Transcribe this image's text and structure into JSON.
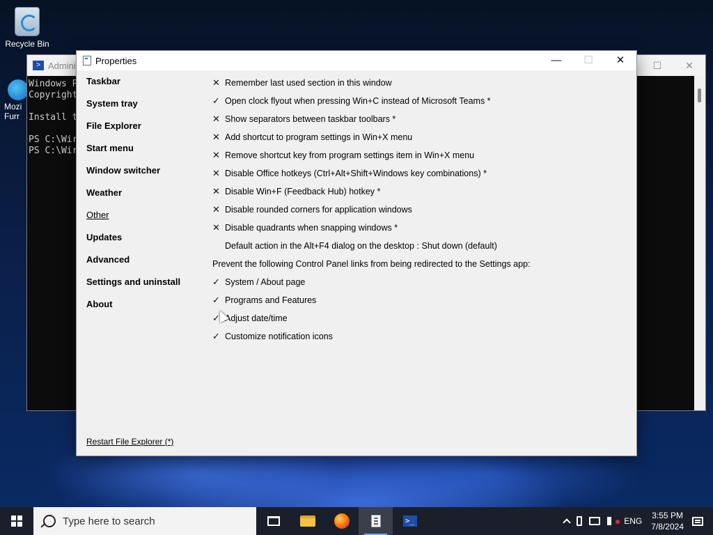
{
  "desktop": {
    "recycle_bin_label": "Recycle Bin",
    "edge_icon_label_1": "Mozi",
    "edge_icon_label_2": "Furr"
  },
  "terminal": {
    "title": "Admini",
    "lines": [
      "Windows P",
      "Copyright",
      "",
      "Install t",
      "",
      "PS C:\\Wir",
      "PS C:\\Wir"
    ]
  },
  "properties": {
    "title": "Properties",
    "window_controls": {
      "minimize": "—",
      "maximize": "☐",
      "close": "✕"
    },
    "nav": [
      "Taskbar",
      "System tray",
      "File Explorer",
      "Start menu",
      "Window switcher",
      "Weather",
      "Other",
      "Updates",
      "Advanced",
      "Settings and uninstall",
      "About"
    ],
    "active_nav": "Other",
    "options": [
      {
        "mark": "✕",
        "text": "Remember last used section in this window"
      },
      {
        "mark": "✓",
        "text": "Open clock flyout when pressing Win+C instead of Microsoft Teams *"
      },
      {
        "mark": "✕",
        "text": "Show separators between taskbar toolbars *"
      },
      {
        "mark": "✕",
        "text": "Add shortcut to program settings in Win+X menu"
      },
      {
        "mark": "✕",
        "text": "Remove shortcut key from program settings item in Win+X menu"
      },
      {
        "mark": "✕",
        "text": "Disable Office hotkeys (Ctrl+Alt+Shift+Windows key combinations) *"
      },
      {
        "mark": "✕",
        "text": "Disable Win+F (Feedback Hub) hotkey *"
      },
      {
        "mark": "✕",
        "text": "Disable rounded corners for application windows"
      },
      {
        "mark": "✕",
        "text": "Disable quadrants when snapping windows *"
      },
      {
        "mark": "",
        "text": "Default action in the Alt+F4 dialog on the desktop : Shut down (default)"
      }
    ],
    "redirect_label": "Prevent the following Control Panel links from being redirected to the Settings app:",
    "redirect_options": [
      {
        "mark": "✓",
        "text": "System / About page"
      },
      {
        "mark": "✓",
        "text": "Programs and Features"
      },
      {
        "mark": "✓",
        "text": "Adjust date/time"
      },
      {
        "mark": "✓",
        "text": "Customize notification icons"
      }
    ],
    "restart_link": "Restart File Explorer (*)"
  },
  "taskbar": {
    "search_placeholder": "Type here to search",
    "language": "ENG",
    "time": "3:55 PM",
    "date": "7/8/2024"
  },
  "colors": {
    "taskbar_bg": "#1a1f2b",
    "window_bg": "#f0f0f0",
    "accent": "#7aa7f0"
  }
}
